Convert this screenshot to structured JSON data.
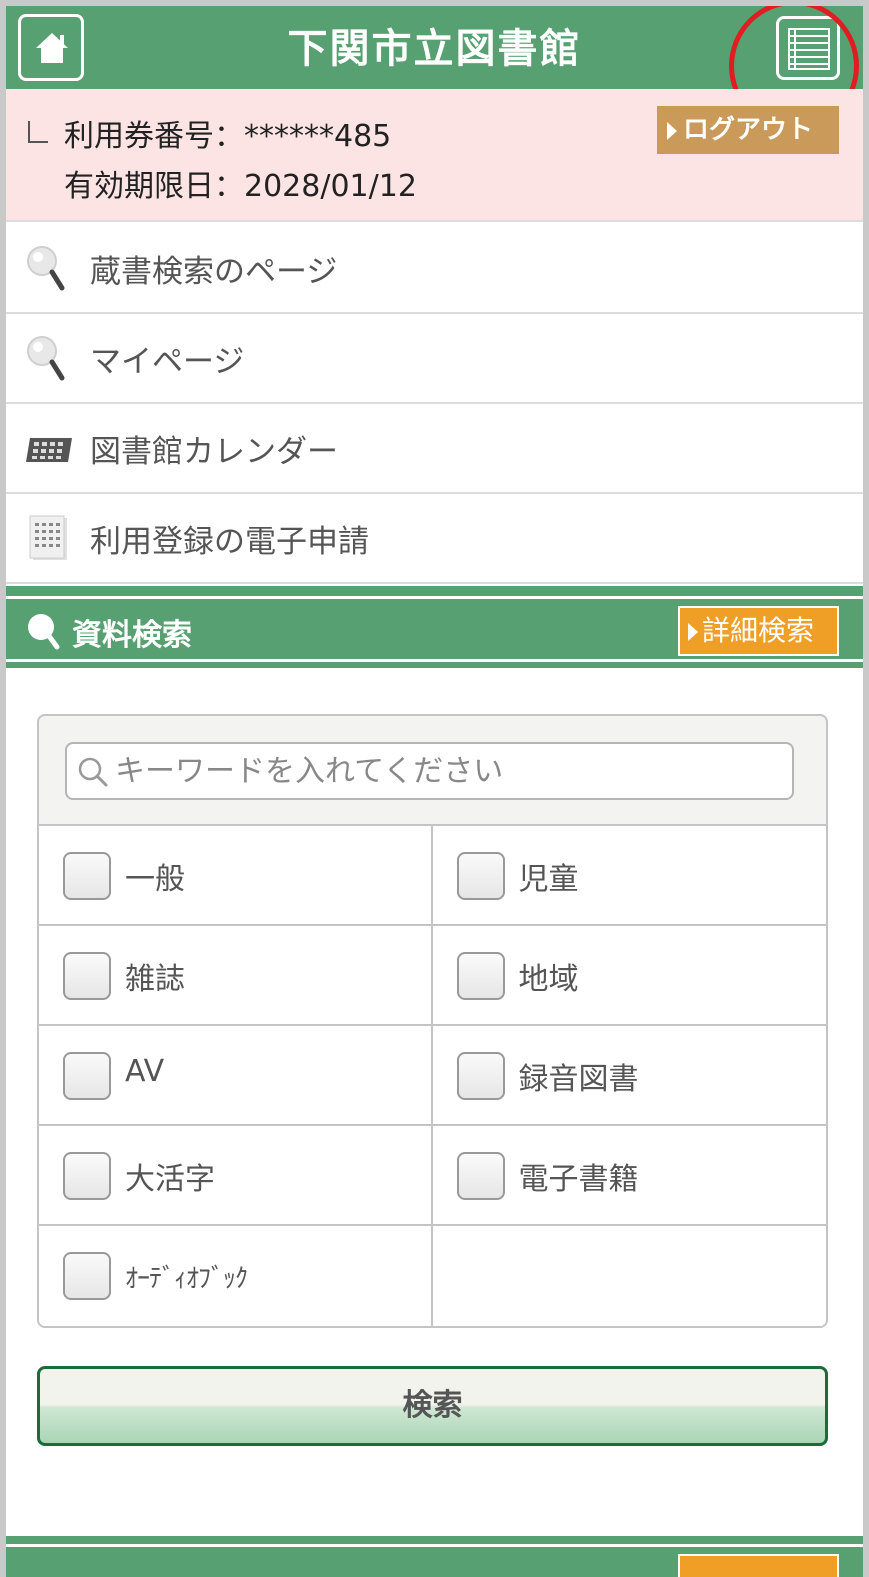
{
  "header": {
    "title": "下関市立図書館",
    "home_icon": "home-icon",
    "menu_icon": "list-menu-icon"
  },
  "user": {
    "card_label": "利用券番号：******485",
    "expiry_label": "有効期限日：2028/01/12",
    "logout_label": "ログアウト"
  },
  "nav": [
    {
      "label": "蔵書検索のページ",
      "icon": "magnifier-icon"
    },
    {
      "label": "マイページ",
      "icon": "magnifier-icon"
    },
    {
      "label": "図書館カレンダー",
      "icon": "calendar-icon"
    },
    {
      "label": "利用登録の電子申請",
      "icon": "form-icon"
    }
  ],
  "search": {
    "section_title": "資料検索",
    "advanced_label": "詳細検索",
    "placeholder": "キーワードを入れてください",
    "value": "",
    "categories": [
      "一般",
      "児童",
      "雑誌",
      "地域",
      "AV",
      "録音図書",
      "大活字",
      "電子書籍",
      "ｵｰﾃﾞｨｵﾌﾞｯｸ"
    ],
    "submit_label": "検索"
  },
  "colors": {
    "green": "#57a071",
    "orange": "#f09f26",
    "logout": "#c99a59",
    "pink": "#fbe4e3",
    "annotation": "#e11d24"
  }
}
